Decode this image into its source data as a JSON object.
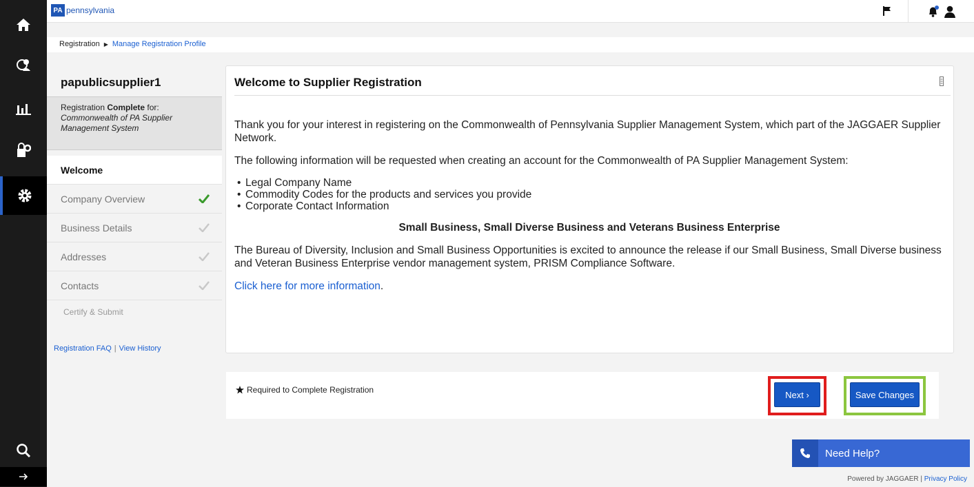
{
  "rail": {
    "items": [
      {
        "icon": "home-icon"
      },
      {
        "icon": "user-globe-icon"
      },
      {
        "icon": "bar-chart-icon"
      },
      {
        "icon": "lock-gear-icon"
      },
      {
        "icon": "gear-icon",
        "active": true
      }
    ],
    "bottom": [
      {
        "icon": "search-icon"
      },
      {
        "icon": "arrow-right-icon"
      }
    ]
  },
  "header": {
    "logo_badge": "PA",
    "logo_text": "pennsylvania",
    "icons": [
      "flag-icon",
      "bell-icon",
      "user-icon"
    ]
  },
  "breadcrumb": {
    "root": "Registration",
    "current": "Manage Registration Profile"
  },
  "left_panel": {
    "username": "papublicsupplier1",
    "status_prefix": "Registration ",
    "status_bold": "Complete",
    "status_suffix": " for:",
    "org": "Commonwealth of PA Supplier Management System",
    "nav": [
      {
        "label": "Welcome",
        "state": "active"
      },
      {
        "label": "Company Overview",
        "state": "complete"
      },
      {
        "label": "Business Details",
        "state": "pending"
      },
      {
        "label": "Addresses",
        "state": "pending"
      },
      {
        "label": "Contacts",
        "state": "pending"
      }
    ],
    "certify": "Certify & Submit",
    "faq_link": "Registration FAQ",
    "link_sep": "|",
    "history_link": "View History"
  },
  "card": {
    "title": "Welcome to Supplier Registration",
    "intro": "Thank you for your interest in registering on the Commonwealth of Pennsylvania Supplier Management System, which part of the JAGGAER Supplier Network.",
    "requested": "The following information will be requested when creating an account for the Commonwealth of PA Supplier Management System:",
    "bullets": [
      "Legal Company Name",
      "Commodity Codes for the products and services you provide",
      "Corporate Contact Information"
    ],
    "section_heading": "Small Business, Small Diverse Business and Veterans Business Enterprise",
    "bureau": "The Bureau of Diversity, Inclusion and Small Business Opportunities is excited to announce the release if our Small Business, Small Diverse business and Veteran Business Enterprise vendor management system, PRISM Compliance Software.",
    "more_link": "Click here for more information",
    "more_tail": "."
  },
  "actions": {
    "required_note": "Required to Complete Registration",
    "next_label": "Next ›",
    "save_label": "Save Changes",
    "highlight_colors": {
      "next": "#e01d1d",
      "save": "#8cc63f"
    }
  },
  "help": {
    "label": "Need Help?"
  },
  "footer": {
    "powered": "Powered by JAGGAER | ",
    "privacy": "Privacy Policy"
  },
  "colors": {
    "accent": "#1658c4",
    "rail": "#1b1b1b",
    "check_green": "#3a9a2c"
  }
}
